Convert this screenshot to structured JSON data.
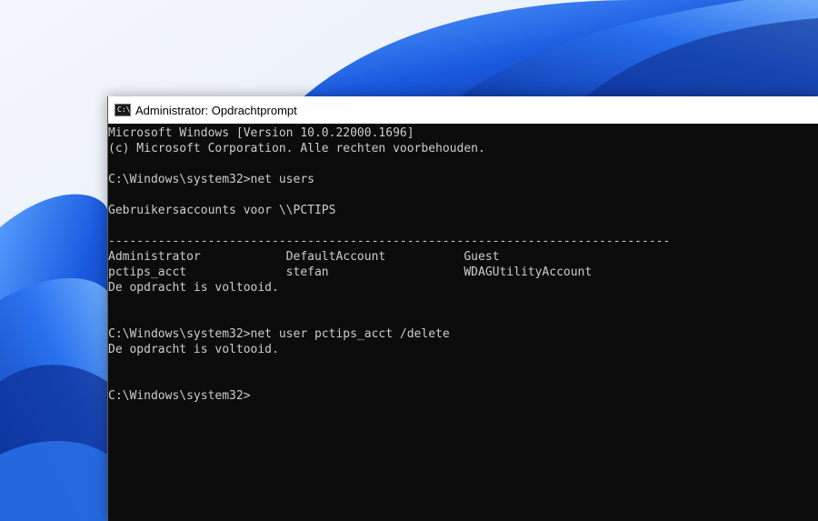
{
  "window": {
    "title": "Administrator: Opdrachtprompt",
    "icon": "cmd-icon"
  },
  "console": {
    "lines": [
      "Microsoft Windows [Version 10.0.22000.1696]",
      "(c) Microsoft Corporation. Alle rechten voorbehouden.",
      "",
      "C:\\Windows\\system32>net users",
      "",
      "Gebruikersaccounts voor \\\\PCTIPS",
      "",
      "-------------------------------------------------------------------------------",
      "Administrator            DefaultAccount           Guest",
      "pctips_acct              stefan                   WDAGUtilityAccount",
      "De opdracht is voltooid.",
      "",
      "",
      "C:\\Windows\\system32>net user pctips_acct /delete",
      "De opdracht is voltooid.",
      "",
      "",
      "C:\\Windows\\system32>"
    ]
  },
  "colors": {
    "console_bg": "#0c0c0c",
    "console_text": "#cccccc",
    "titlebar_bg": "#ffffff",
    "wallpaper_blue": "#1f5fe0"
  }
}
